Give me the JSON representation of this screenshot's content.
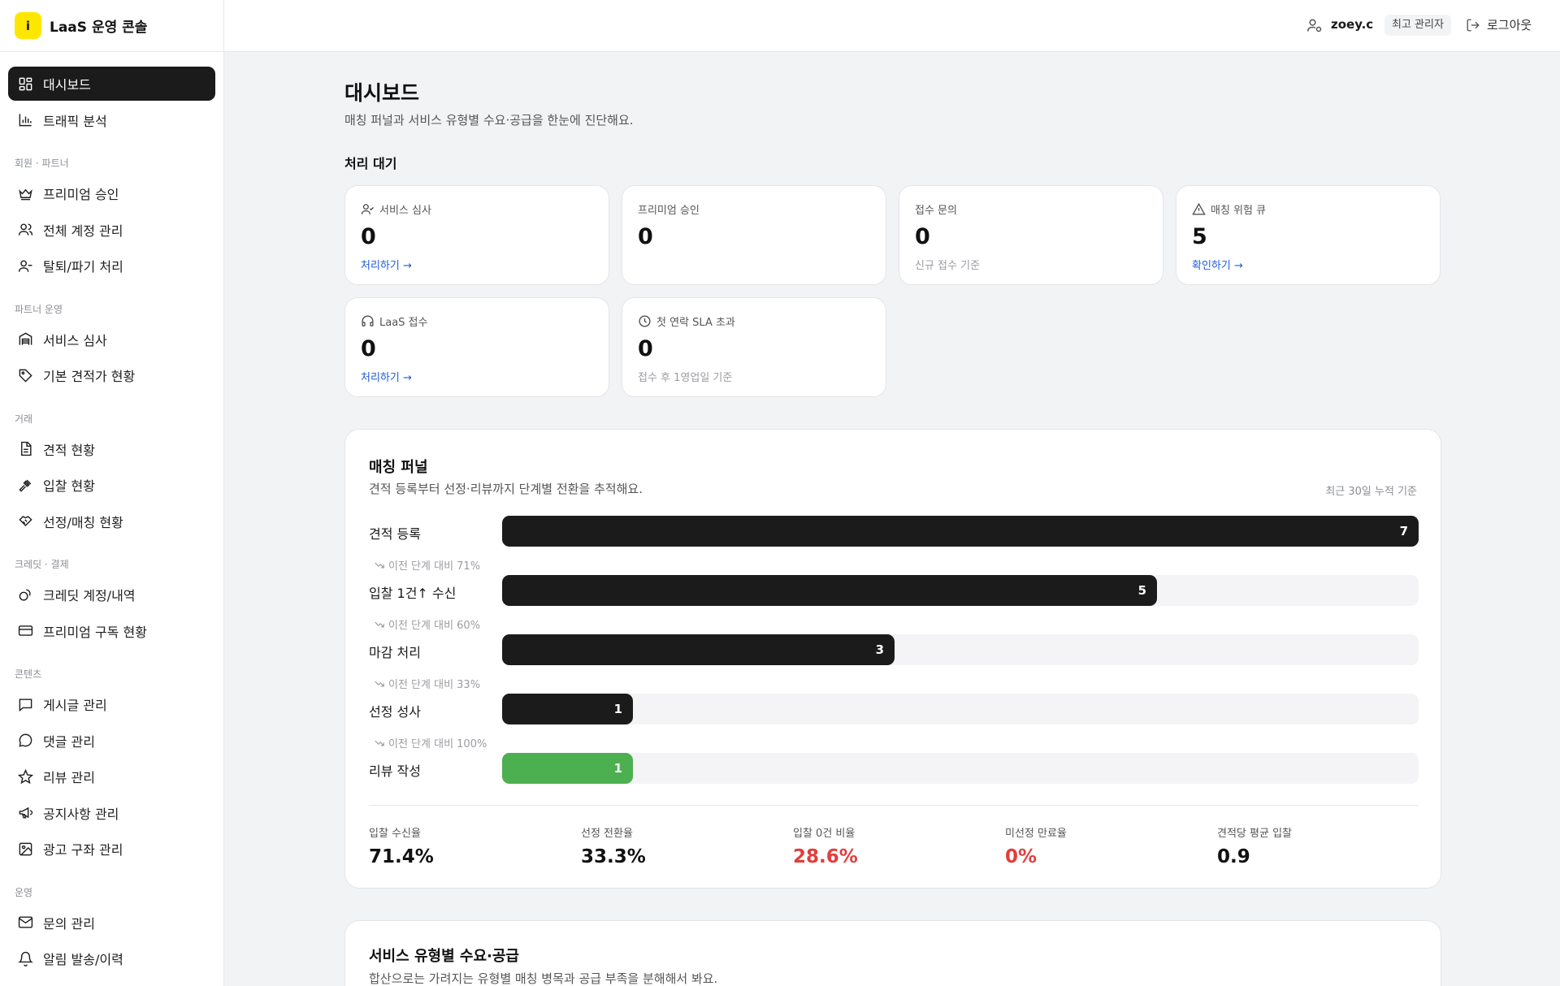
{
  "app": {
    "logo_letter": "i",
    "title": "LaaS 운영 콘솔"
  },
  "header": {
    "user_name": "zoey.c",
    "role": "최고 관리자",
    "logout_label": "로그아웃"
  },
  "sidebar": {
    "top": [
      {
        "label": "대시보드",
        "icon": "dashboard-icon",
        "active": true
      },
      {
        "label": "트래픽 분석",
        "icon": "bar-chart-icon"
      }
    ],
    "sections": [
      {
        "title": "회원 · 파트너",
        "items": [
          {
            "label": "프리미엄 승인",
            "icon": "crown-icon"
          },
          {
            "label": "전체 계정 관리",
            "icon": "users-icon"
          },
          {
            "label": "탈퇴/파기 처리",
            "icon": "user-minus-icon"
          }
        ]
      },
      {
        "title": "파트너 운영",
        "items": [
          {
            "label": "서비스 심사",
            "icon": "warehouse-icon"
          },
          {
            "label": "기본 견적가 현황",
            "icon": "tag-icon"
          }
        ]
      },
      {
        "title": "거래",
        "items": [
          {
            "label": "견적 현황",
            "icon": "document-icon"
          },
          {
            "label": "입찰 현황",
            "icon": "gavel-icon"
          },
          {
            "label": "선정/매칭 현황",
            "icon": "handshake-icon"
          }
        ]
      },
      {
        "title": "크레딧 · 결제",
        "items": [
          {
            "label": "크레딧 계정/내역",
            "icon": "coins-icon"
          },
          {
            "label": "프리미엄 구독 현황",
            "icon": "credit-card-icon"
          }
        ]
      },
      {
        "title": "콘텐츠",
        "items": [
          {
            "label": "게시글 관리",
            "icon": "message-square-icon"
          },
          {
            "label": "댓글 관리",
            "icon": "message-circle-icon"
          },
          {
            "label": "리뷰 관리",
            "icon": "star-icon"
          },
          {
            "label": "공지사항 관리",
            "icon": "megaphone-icon"
          },
          {
            "label": "광고 구좌 관리",
            "icon": "image-icon"
          }
        ]
      },
      {
        "title": "운영",
        "items": [
          {
            "label": "문의 관리",
            "icon": "mail-icon"
          },
          {
            "label": "알림 발송/이력",
            "icon": "bell-icon"
          }
        ]
      }
    ]
  },
  "page": {
    "title": "대시보드",
    "subtitle": "매칭 퍼널과 서비스 유형별 수요·공급을 한눈에 진단해요.",
    "pending_title": "처리 대기"
  },
  "pending_cards": [
    {
      "label": "서비스 심사",
      "icon": "user-check-icon",
      "value": "0",
      "link": "처리하기 →"
    },
    {
      "label": "프리미엄 승인",
      "icon": "",
      "value": "0"
    },
    {
      "label": "접수 문의",
      "icon": "",
      "value": "0",
      "note": "신규 접수 기준"
    },
    {
      "label": "매칭 위험 큐",
      "icon": "warning-icon",
      "value": "5",
      "link": "확인하기 →"
    },
    {
      "label": "LaaS 접수",
      "icon": "headset-icon",
      "value": "0",
      "link": "처리하기 →"
    },
    {
      "label": "첫 연락 SLA 초과",
      "icon": "clock-icon",
      "value": "0",
      "note": "접수 후 1영업일 기준"
    }
  ],
  "funnel": {
    "title": "매칭 퍼널",
    "subtitle": "견적 등록부터 선정·리뷰까지 단계별 전환을 추적해요.",
    "period_note": "최근 30일 누적 기준",
    "max": 7,
    "stages": [
      {
        "label": "견적 등록",
        "value": 7
      },
      {
        "label": "입찰 1건↑ 수신",
        "value": 5,
        "conversion": "이전 단계 대비 71%"
      },
      {
        "label": "마감 처리",
        "value": 3,
        "conversion": "이전 단계 대비 60%"
      },
      {
        "label": "선정 성사",
        "value": 1,
        "conversion": "이전 단계 대비 33%"
      },
      {
        "label": "리뷰 작성",
        "value": 1,
        "conversion": "이전 단계 대비 100%",
        "color": "#4caf50"
      }
    ],
    "stats": [
      {
        "label": "입찰 수신율",
        "value": "71.4%"
      },
      {
        "label": "선정 전환율",
        "value": "33.3%"
      },
      {
        "label": "입찰 0건 비율",
        "value": "28.6%",
        "alert": true
      },
      {
        "label": "미선정 만료율",
        "value": "0%",
        "alert": true
      },
      {
        "label": "견적당 평균 입찰",
        "value": "0.9"
      }
    ]
  },
  "supply": {
    "title": "서비스 유형별 수요·공급",
    "subtitle": "합산으로는 가려지는 유형별 매칭 병목과 공급 부족을 분해해서 봐요."
  },
  "colors": {
    "active_nav": "#1b1b1b",
    "link": "#1f5bd9",
    "alert": "#e23d3d",
    "success": "#4caf50",
    "brand": "#ffe600"
  }
}
